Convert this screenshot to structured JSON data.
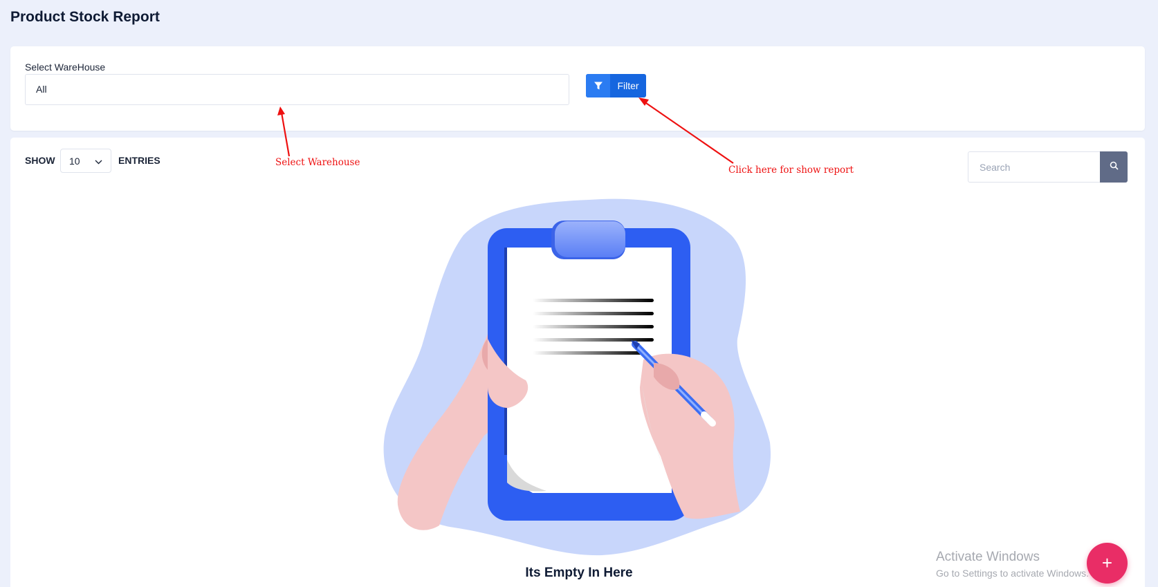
{
  "page": {
    "title": "Product Stock Report"
  },
  "filter": {
    "warehouse_label": "Select WareHouse",
    "warehouse_value": "All",
    "filter_button_label": "Filter"
  },
  "table": {
    "show_label": "SHOW",
    "entries_value": "10",
    "entries_label": "ENTRIES",
    "search_placeholder": "Search"
  },
  "empty_state": {
    "message": "Its Empty In Here"
  },
  "annotations": {
    "select_warehouse": "Select Warehouse",
    "click_filter": "Click here for show report"
  },
  "watermark": {
    "line1": "Activate Windows",
    "line2": "Go to Settings to activate Windows."
  },
  "fab": {
    "label": "+"
  },
  "colors": {
    "background": "#ecf0fb",
    "primary": "#1666df",
    "search_button": "#606b87",
    "fab": "#e92d66",
    "annotation": "#ee1111",
    "illustration_blob": "#c8d6fb",
    "clipboard": "#2d5ef2"
  },
  "icons": {
    "filter_button": "filter-funnel-icon",
    "entries_select": "chevron-down-icon",
    "search_button": "search-icon",
    "fab": "plus-icon"
  }
}
